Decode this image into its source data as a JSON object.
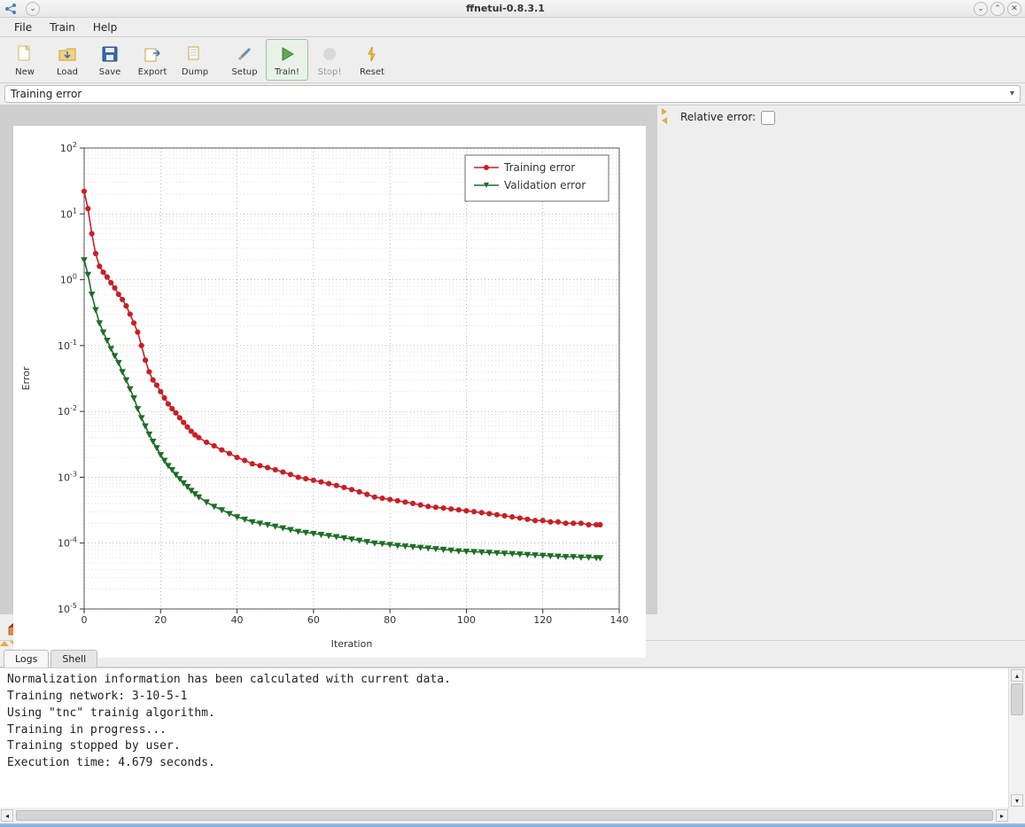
{
  "window": {
    "title": "ffnetui-0.8.3.1"
  },
  "menu": {
    "file": "File",
    "train": "Train",
    "help": "Help"
  },
  "toolbar": {
    "new": "New",
    "load": "Load",
    "save": "Save",
    "export": "Export",
    "dump": "Dump",
    "setup": "Setup",
    "train": "Train!",
    "stop": "Stop!",
    "reset": "Reset"
  },
  "combo": {
    "selected": "Training error"
  },
  "side": {
    "relative_error": "Relative error:"
  },
  "plot_toolbar": {
    "home": "home-icon",
    "pan": "pan-icon",
    "zoom": "zoom-icon",
    "save": "save-icon",
    "config": "config-icon"
  },
  "tabs": {
    "logs": "Logs",
    "shell": "Shell"
  },
  "log": {
    "lines": [
      "Normalization information has been calculated with current data.",
      "Training network: 3-10-5-1",
      "Using \"tnc\" trainig algorithm.",
      "Training in progress...",
      "Training stopped by user.",
      "Execution time: 4.679 seconds."
    ]
  },
  "chart_data": {
    "type": "line",
    "xlabel": "Iteration",
    "ylabel": "Error",
    "xlim": [
      0,
      140
    ],
    "ylim": [
      1e-05,
      100.0
    ],
    "yscale": "log",
    "xticks": [
      0,
      20,
      40,
      60,
      80,
      100,
      120,
      140
    ],
    "yticks": [
      1e-05,
      0.0001,
      0.001,
      0.01,
      0.1,
      1,
      10,
      100
    ],
    "ytick_labels": [
      "10⁻⁵",
      "10⁻⁴",
      "10⁻³",
      "10⁻²",
      "10⁻¹",
      "10⁰",
      "10¹",
      "10²"
    ],
    "legend": {
      "position": "upper right",
      "entries": [
        "Training error",
        "Validation error"
      ]
    },
    "series": [
      {
        "name": "Training error",
        "color": "#c62127",
        "marker": "circle",
        "x": [
          0,
          1,
          2,
          3,
          4,
          5,
          6,
          7,
          8,
          9,
          10,
          11,
          12,
          13,
          14,
          15,
          16,
          17,
          18,
          19,
          20,
          21,
          22,
          23,
          24,
          25,
          26,
          27,
          28,
          29,
          30,
          32,
          34,
          36,
          38,
          40,
          42,
          44,
          46,
          48,
          50,
          52,
          54,
          56,
          58,
          60,
          62,
          64,
          66,
          68,
          70,
          72,
          74,
          76,
          78,
          80,
          82,
          84,
          86,
          88,
          90,
          92,
          94,
          96,
          98,
          100,
          102,
          104,
          106,
          108,
          110,
          112,
          114,
          116,
          118,
          120,
          122,
          124,
          126,
          128,
          130,
          132,
          134,
          135
        ],
        "y": [
          22,
          12,
          5,
          2.5,
          1.6,
          1.3,
          1.1,
          0.9,
          0.75,
          0.6,
          0.5,
          0.4,
          0.3,
          0.22,
          0.16,
          0.1,
          0.06,
          0.04,
          0.03,
          0.025,
          0.02,
          0.016,
          0.013,
          0.011,
          0.0095,
          0.008,
          0.0068,
          0.0058,
          0.005,
          0.0044,
          0.004,
          0.0034,
          0.003,
          0.0026,
          0.0023,
          0.002,
          0.0018,
          0.0016,
          0.0015,
          0.0014,
          0.0013,
          0.0012,
          0.0011,
          0.001,
          0.00095,
          0.0009,
          0.00085,
          0.0008,
          0.00075,
          0.0007,
          0.00065,
          0.0006,
          0.00055,
          0.0005,
          0.00048,
          0.00046,
          0.00044,
          0.00042,
          0.0004,
          0.00038,
          0.00036,
          0.00035,
          0.00034,
          0.00033,
          0.00032,
          0.00031,
          0.0003,
          0.00029,
          0.00028,
          0.00027,
          0.00026,
          0.00025,
          0.00024,
          0.00023,
          0.00022,
          0.00022,
          0.00021,
          0.00021,
          0.0002,
          0.0002,
          0.0002,
          0.00019,
          0.00019,
          0.00019
        ]
      },
      {
        "name": "Validation error",
        "color": "#1e6e28",
        "marker": "triangle-down",
        "x": [
          0,
          1,
          2,
          3,
          4,
          5,
          6,
          7,
          8,
          9,
          10,
          11,
          12,
          13,
          14,
          15,
          16,
          17,
          18,
          19,
          20,
          21,
          22,
          23,
          24,
          25,
          26,
          27,
          28,
          29,
          30,
          32,
          34,
          36,
          38,
          40,
          42,
          44,
          46,
          48,
          50,
          52,
          54,
          56,
          58,
          60,
          62,
          64,
          66,
          68,
          70,
          72,
          74,
          76,
          78,
          80,
          82,
          84,
          86,
          88,
          90,
          92,
          94,
          96,
          98,
          100,
          102,
          104,
          106,
          108,
          110,
          112,
          114,
          116,
          118,
          120,
          122,
          124,
          126,
          128,
          130,
          132,
          134,
          135
        ],
        "y": [
          2,
          1.2,
          0.6,
          0.35,
          0.22,
          0.16,
          0.12,
          0.09,
          0.07,
          0.055,
          0.04,
          0.03,
          0.022,
          0.016,
          0.011,
          0.008,
          0.006,
          0.0045,
          0.0035,
          0.0028,
          0.0022,
          0.0018,
          0.0015,
          0.0013,
          0.0011,
          0.00095,
          0.00082,
          0.00072,
          0.00063,
          0.00056,
          0.0005,
          0.00042,
          0.00036,
          0.00032,
          0.00028,
          0.00025,
          0.00023,
          0.00021,
          0.0002,
          0.00019,
          0.00018,
          0.00017,
          0.00016,
          0.00015,
          0.000145,
          0.00014,
          0.000135,
          0.00013,
          0.000125,
          0.00012,
          0.000115,
          0.00011,
          0.000105,
          0.0001,
          9.8e-05,
          9.5e-05,
          9.2e-05,
          9e-05,
          8.8e-05,
          8.6e-05,
          8.4e-05,
          8.2e-05,
          8e-05,
          7.8e-05,
          7.6e-05,
          7.5e-05,
          7.4e-05,
          7.3e-05,
          7.2e-05,
          7.1e-05,
          7e-05,
          6.9e-05,
          6.8e-05,
          6.7e-05,
          6.6e-05,
          6.5e-05,
          6.4e-05,
          6.3e-05,
          6.2e-05,
          6.2e-05,
          6.1e-05,
          6.1e-05,
          6e-05,
          6e-05
        ]
      }
    ]
  }
}
